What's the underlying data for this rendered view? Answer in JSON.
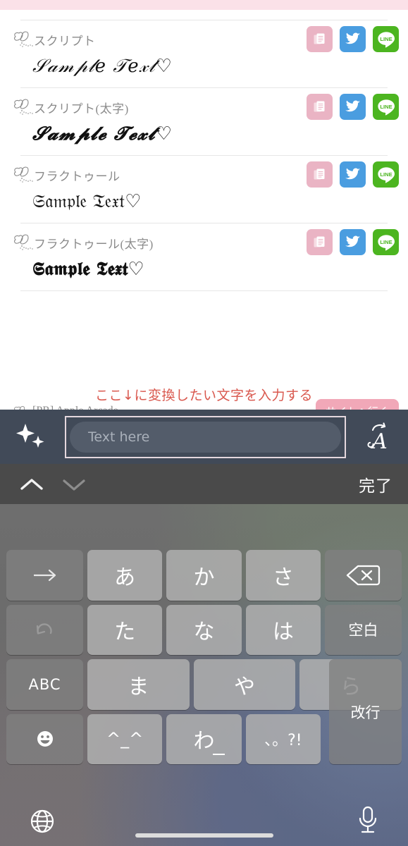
{
  "page": {
    "top_strip_color": "#fbe1e8",
    "annotation": "ここ↓に変換したい文字を入力する",
    "annotation_color": "#d9584e",
    "pr_label": "[PR] Apple Arcade",
    "pr_button": "サイトへ行く"
  },
  "font_rows": [
    {
      "label": "スクリプト",
      "sample": "𝒮𝒶𝓂𝓅𝓁𝑒 𝒯𝑒𝓍𝓉♡",
      "actions": {
        "copy": "copy-icon",
        "twitter": "twitter-icon",
        "line": "LINE"
      }
    },
    {
      "label": "スクリプト(太字)",
      "sample": "𝓢𝓪𝓶𝓹𝓵𝓮 𝓣𝓮𝔁𝓽♡",
      "actions": {
        "copy": "copy-icon",
        "twitter": "twitter-icon",
        "line": "LINE"
      }
    },
    {
      "label": "フラクトゥール",
      "sample": "𝔖𝔞𝔪𝔭𝔩𝔢 𝔗𝔢𝔵𝔱♡",
      "actions": {
        "copy": "copy-icon",
        "twitter": "twitter-icon",
        "line": "LINE"
      }
    },
    {
      "label": "フラクトゥール(太字)",
      "sample": "𝕾𝖆𝖒𝖕𝖑𝖊 𝕿𝖊𝖝𝖙♡",
      "actions": {
        "copy": "copy-icon",
        "twitter": "twitter-icon",
        "line": "LINE"
      }
    }
  ],
  "accessory_bar": {
    "background": "#414a58",
    "sparkle_icon": "sparkles-icon",
    "input_placeholder": "Text here",
    "input_value": "",
    "font_transform_icon": "script-a-icon"
  },
  "nav_bar": {
    "background": "#4a4a4a",
    "prev_icon": "chevron-up-icon",
    "next_icon": "chevron-down-icon",
    "done_label": "完了"
  },
  "keyboard": {
    "type": "japanese-kana-12key",
    "rows": [
      [
        {
          "name": "cursor-right-key",
          "label": "→",
          "kind": "fn"
        },
        {
          "name": "key-a",
          "label": "あ",
          "kind": "ch"
        },
        {
          "name": "key-ka",
          "label": "か",
          "kind": "ch"
        },
        {
          "name": "key-sa",
          "label": "さ",
          "kind": "ch"
        },
        {
          "name": "delete-key",
          "label": "⌫",
          "kind": "fn"
        }
      ],
      [
        {
          "name": "undo-key",
          "label": "↺",
          "kind": "fn"
        },
        {
          "name": "key-ta",
          "label": "た",
          "kind": "ch"
        },
        {
          "name": "key-na",
          "label": "な",
          "kind": "ch"
        },
        {
          "name": "key-ha",
          "label": "は",
          "kind": "ch"
        },
        {
          "name": "space-key",
          "label": "空白",
          "kind": "fn"
        }
      ],
      [
        {
          "name": "abc-key",
          "label": "ABC",
          "kind": "fn"
        },
        {
          "name": "key-ma",
          "label": "ま",
          "kind": "ch"
        },
        {
          "name": "key-ya",
          "label": "や",
          "kind": "ch"
        },
        {
          "name": "key-ra",
          "label": "ら",
          "kind": "ch"
        },
        {
          "name": "return-key",
          "label": "改行",
          "kind": "fn"
        }
      ],
      [
        {
          "name": "emoji-key",
          "label": "☺",
          "kind": "fn"
        },
        {
          "name": "kaomoji-key",
          "label": "^_^",
          "kind": "ch"
        },
        {
          "name": "key-wa",
          "label": "わ",
          "kind": "ch"
        },
        {
          "name": "punctuation-key",
          "label": "、。?!",
          "kind": "ch"
        }
      ]
    ],
    "bottom": {
      "globe_icon": "globe-icon",
      "mic_icon": "microphone-icon"
    }
  }
}
